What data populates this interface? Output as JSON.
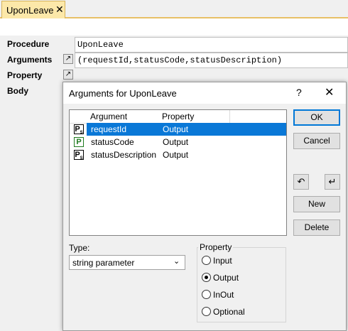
{
  "tab": {
    "title": "UponLeave",
    "close": "✕"
  },
  "grid": {
    "procedure": {
      "label": "Procedure",
      "value": "UponLeave"
    },
    "arguments": {
      "label": "Arguments",
      "value": "(requestId,statusCode,statusDescription)"
    },
    "property": {
      "label": "Property"
    },
    "body": {
      "label": "Body"
    },
    "ellipsis": "↗"
  },
  "dialog": {
    "title": "Arguments for UponLeave",
    "help": "?",
    "close": "✕",
    "columns": [
      "Argument",
      "Property"
    ],
    "rows": [
      {
        "icon": "P",
        "icon_sub": "S",
        "argument": "requestId",
        "property": "Output",
        "selected": true
      },
      {
        "icon": "P",
        "icon_sub": "",
        "argument": "statusCode",
        "property": "Output",
        "selected": false
      },
      {
        "icon": "P",
        "icon_sub": "S",
        "argument": "statusDescription",
        "property": "Output",
        "selected": false
      }
    ],
    "buttons": {
      "ok": "OK",
      "cancel": "Cancel",
      "new": "New",
      "delete": "Delete",
      "undo": "↶",
      "enter": "↵"
    },
    "type": {
      "label": "Type:",
      "value": "string parameter",
      "chevron": "⌵"
    },
    "property": {
      "legend": "Property",
      "options": [
        "Input",
        "Output",
        "InOut",
        "Optional"
      ],
      "selected": "Output"
    }
  },
  "colors": {
    "accent": "#0078d7",
    "selection": "#0a78d7",
    "tab": "#fce8a9",
    "icon_green": "#1e7a1e"
  }
}
